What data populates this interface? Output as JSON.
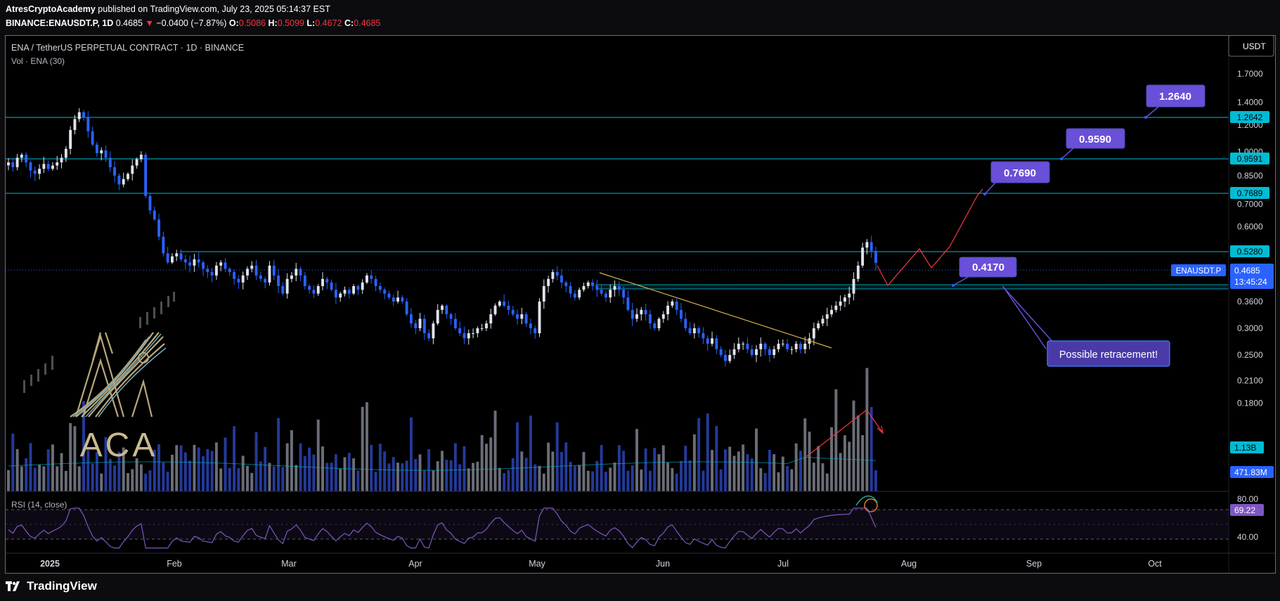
{
  "header": {
    "author": "AtresCryptoAcademy",
    "published_text": " published on TradingView.com, July 23, 2025 05:14:37 EST",
    "symbol_line": "BINANCE:ENAUSDT.P, 1D",
    "last": "0.4685",
    "change": "−0.0400 (−7.87%)",
    "o_label": "O:",
    "o": "0.5086",
    "h_label": "H:",
    "h": "0.5099",
    "l_label": "L:",
    "l": "0.4672",
    "c_label": "C:",
    "c": "0.4685"
  },
  "legend": {
    "instrument": "ENA / TetherUS PERPETUAL CONTRACT · 1D · BINANCE",
    "volume": "Vol · ENA (30)",
    "rsi": "RSI (14, close)"
  },
  "currency_button": "USDT",
  "logo": {
    "text": "ACA",
    "platform": "TradingView"
  },
  "colors": {
    "up": "#e0e3eb",
    "down": "#2962ff",
    "level": "#00bcd4",
    "label_bg": "#6a4fd8",
    "trend": "#d4b14a",
    "arrow": "#f23645",
    "rsi": "#7e57c2"
  },
  "chart_data": {
    "type": "candlestick",
    "price_axis": {
      "ticks": [
        "1.7000",
        "1.4000",
        "1.2000",
        "1.0000",
        "0.8500",
        "0.7000",
        "0.6000",
        "0.5000",
        "0.4200",
        "0.3600",
        "0.3000",
        "0.2500",
        "0.2100",
        "0.1800"
      ],
      "scale": "log"
    },
    "time_axis": {
      "labels": [
        "2025",
        "Feb",
        "Mar",
        "Apr",
        "May",
        "Jun",
        "Jul",
        "Aug",
        "Sep",
        "Oct"
      ]
    },
    "current_price": {
      "symbol": "ENAUSDT.P",
      "price": "0.4685",
      "countdown": "13:45:24"
    },
    "levels": [
      {
        "price": 1.2642,
        "label": "1.2642"
      },
      {
        "price": 0.9591,
        "label": "0.9591"
      },
      {
        "price": 0.7689,
        "label": "0.7689"
      },
      {
        "price": 0.528,
        "label": "0.5280"
      }
    ],
    "annotations": {
      "targets": [
        "1.2640",
        "0.9590",
        "0.7690",
        "0.4170"
      ],
      "note": "Possible retracement!"
    },
    "volume": {
      "ma_label": "1.13B",
      "last_label": "471.83M"
    },
    "rsi": {
      "value": "69.22",
      "ticks": [
        "80.00",
        "40.00"
      ]
    },
    "series": [
      {
        "date": "Jan",
        "close": [
          0.93,
          0.9,
          0.96,
          0.98,
          0.93,
          0.88,
          0.86,
          0.89,
          0.92,
          0.89,
          0.91,
          0.93,
          0.96,
          1.02,
          1.16,
          1.25,
          1.31,
          1.26,
          1.15,
          1.05,
          0.99,
          1.01,
          0.96,
          0.9,
          0.85,
          0.8,
          0.83,
          0.86,
          0.91,
          0.95,
          0.98
        ]
      },
      {
        "date": "Feb",
        "close": [
          0.74,
          0.67,
          0.63,
          0.56,
          0.5,
          0.47,
          0.49,
          0.5,
          0.48,
          0.47,
          0.46,
          0.48,
          0.47,
          0.45,
          0.44,
          0.43,
          0.46,
          0.47,
          0.45,
          0.44,
          0.42,
          0.41,
          0.43,
          0.45,
          0.46,
          0.43,
          0.42,
          0.41
        ]
      },
      {
        "date": "Mar",
        "close": [
          0.46,
          0.43,
          0.4,
          0.38,
          0.42,
          0.43,
          0.45,
          0.43,
          0.4,
          0.39,
          0.38,
          0.4,
          0.42,
          0.41,
          0.39,
          0.37,
          0.38,
          0.39,
          0.38,
          0.4,
          0.39,
          0.41,
          0.43,
          0.42,
          0.4,
          0.39,
          0.38,
          0.37,
          0.36,
          0.37,
          0.36
        ]
      },
      {
        "date": "Apr",
        "close": [
          0.33,
          0.31,
          0.3,
          0.32,
          0.29,
          0.28,
          0.31,
          0.34,
          0.35,
          0.33,
          0.32,
          0.3,
          0.29,
          0.28,
          0.29,
          0.29,
          0.3,
          0.3,
          0.31,
          0.33,
          0.35,
          0.36,
          0.35,
          0.34,
          0.33,
          0.32,
          0.33,
          0.31,
          0.3,
          0.29
        ]
      },
      {
        "date": "May",
        "close": [
          0.36,
          0.4,
          0.42,
          0.44,
          0.43,
          0.41,
          0.4,
          0.38,
          0.37,
          0.39,
          0.4,
          0.41,
          0.4,
          0.39,
          0.38,
          0.37,
          0.39,
          0.4,
          0.39,
          0.37,
          0.34,
          0.32,
          0.33,
          0.34,
          0.33,
          0.31,
          0.3,
          0.32,
          0.33,
          0.35,
          0.36
        ]
      },
      {
        "date": "Jun",
        "close": [
          0.34,
          0.32,
          0.3,
          0.29,
          0.3,
          0.29,
          0.28,
          0.27,
          0.28,
          0.26,
          0.25,
          0.24,
          0.25,
          0.26,
          0.27,
          0.27,
          0.26,
          0.25,
          0.26,
          0.27,
          0.26,
          0.25,
          0.26,
          0.27,
          0.27,
          0.26,
          0.26,
          0.27,
          0.26,
          0.27
        ]
      },
      {
        "date": "Jul",
        "close": [
          0.28,
          0.3,
          0.31,
          0.32,
          0.33,
          0.34,
          0.35,
          0.36,
          0.37,
          0.38,
          0.42,
          0.46,
          0.52,
          0.54,
          0.5086,
          0.4685
        ]
      }
    ],
    "projection": [
      0.4685,
      0.425,
      0.49,
      0.455,
      0.515,
      0.7689
    ],
    "secondary_projection": [
      0.4685,
      0.42,
      0.9591
    ]
  }
}
